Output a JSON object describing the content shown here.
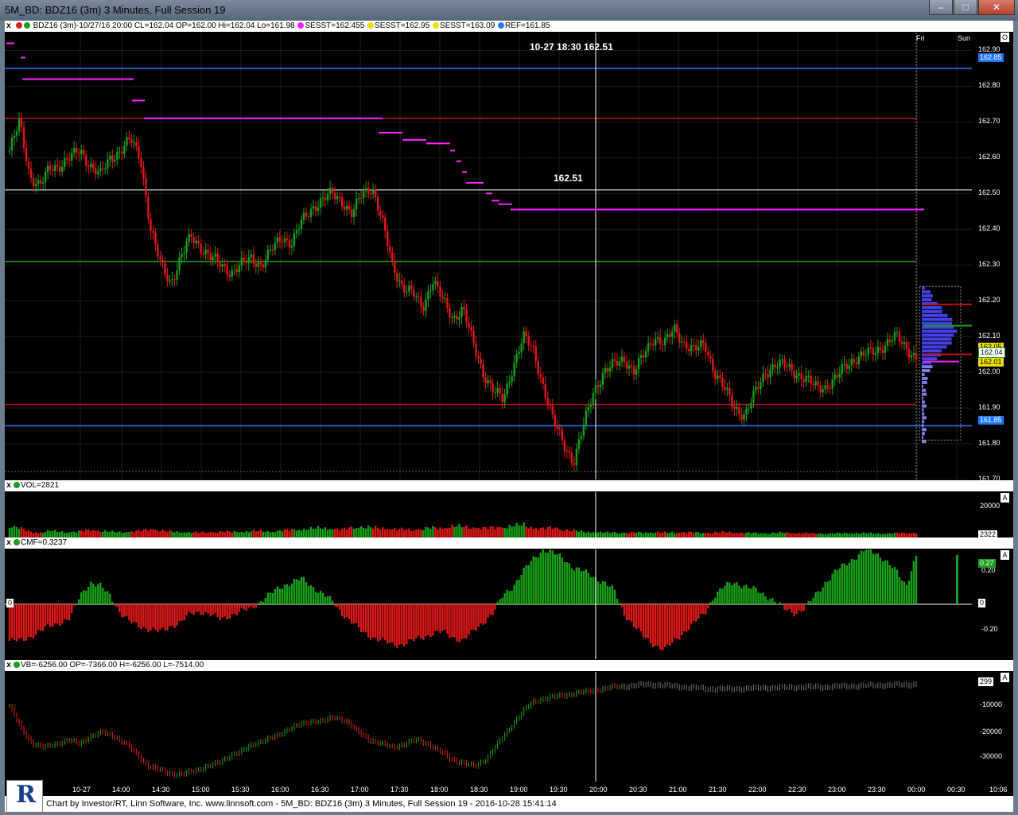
{
  "window": {
    "title": "5M_BD: BDZ16 (3m) 3 Minutes, Full Session 19",
    "buttons": [
      "–",
      "□",
      "✕"
    ]
  },
  "price_panel": {
    "header": {
      "close_label": "x",
      "summary": "BDZ16 (3m)-10/27/16 20:00 CL=162.04 OP=162.00 Hi=162.04 Lo=161.98",
      "sesst1": "SESST=162.455",
      "sesst2": "SESST=162.95",
      "sesst3": "SESST=163.09",
      "ref": "REF=161.85"
    },
    "crosshair_label": "10-27 18:30  162.51",
    "line_label": "162.51",
    "day_labels": [
      "Fri",
      "Sun"
    ],
    "corner_button": "O",
    "y_ticks": [
      "162.90",
      "162.80",
      "162.70",
      "162.60",
      "162.50",
      "162.40",
      "162.30",
      "162.20",
      "162.10",
      "162.00",
      "161.90",
      "161.80",
      "161.70"
    ],
    "tags": {
      "ref_top": "162.85",
      "ref_bottom": "161.85",
      "last": "162.04",
      "yellow1": "162.05",
      "yellow2": "162.01"
    }
  },
  "vol_panel": {
    "header": "VOL=2821",
    "button": "A",
    "y_tick": "20000",
    "last": "2322"
  },
  "cmf_panel": {
    "header": "CMF=0.3237",
    "button": "A",
    "ticks": [
      "0.20",
      "0",
      "-0.20"
    ],
    "last": "0.27",
    "zero": "0"
  },
  "vb_panel": {
    "header": "VB=-6256.00 OP=-7366.00 H=-6256.00 L=-7514.00",
    "button": "A",
    "ticks": [
      "-10000",
      "-20000",
      "-30000"
    ],
    "last": "299"
  },
  "time_axis": [
    "10-27",
    "14:00",
    "14:30",
    "15:00",
    "15:30",
    "16:00",
    "16:30",
    "17:00",
    "17:30",
    "18:00",
    "18:30",
    "19:00",
    "19:30",
    "20:00",
    "20:30",
    "21:00",
    "21:30",
    "22:00",
    "22:30",
    "23:00",
    "23:30",
    "00:00",
    "00:30",
    "10:06"
  ],
  "footer": {
    "credit": "Chart by Investor/RT, Linn Software, Inc. www.linnsoft.com - 5M_BD: BDZ16 (3m) 3 Minutes, Full Session 19 - 2016-10-28 15:41:14",
    "logo_letter": "R"
  },
  "chart_data": {
    "type": "candlestick",
    "symbol": "BDZ16",
    "price_path": [
      162.62,
      162.7,
      162.55,
      162.52,
      162.57,
      162.58,
      162.6,
      162.62,
      162.58,
      162.55,
      162.6,
      162.62,
      162.65,
      162.6,
      162.4,
      162.3,
      162.25,
      162.32,
      162.38,
      162.35,
      162.32,
      162.3,
      162.28,
      162.3,
      162.32,
      162.3,
      162.34,
      162.38,
      162.36,
      162.42,
      162.46,
      162.48,
      162.5,
      162.48,
      162.44,
      162.5,
      162.52,
      162.42,
      162.3,
      162.24,
      162.22,
      162.18,
      162.26,
      162.2,
      162.15,
      162.18,
      162.08,
      162.0,
      161.95,
      161.92,
      162.02,
      162.1,
      162.06,
      161.96,
      161.86,
      161.8,
      161.75,
      161.85,
      161.95,
      162.0,
      162.02,
      162.04,
      162.0,
      162.05,
      162.1,
      162.08,
      162.12,
      162.08,
      162.06,
      162.08,
      162.0,
      161.95,
      161.9,
      161.88,
      161.94,
      162.0,
      162.02,
      162.02,
      162.0,
      161.98,
      161.96,
      161.96,
      161.98,
      162.02,
      162.04,
      162.05,
      162.06,
      162.08,
      162.1,
      162.07,
      162.04
    ],
    "reference_lines": [
      162.85,
      162.71,
      162.31,
      161.91,
      161.85
    ],
    "crosshair": {
      "time": "10-27 18:30",
      "price": 162.51
    },
    "sesst_levels": [
      162.455,
      162.95,
      163.09
    ],
    "vol_path": [
      6000,
      5000,
      3000,
      2500,
      3500,
      3000,
      2800,
      3200,
      4000,
      3500,
      3000,
      2800,
      3000,
      3500,
      4500,
      3800,
      3000,
      2800,
      2700,
      2600,
      2800,
      3000,
      2900,
      3000,
      3200,
      3400,
      3000,
      3500,
      4000,
      4200,
      4500,
      5000,
      4500,
      4000,
      5200,
      5500,
      5000,
      4800,
      4500,
      4200,
      4000,
      4500,
      5000,
      4800,
      6000,
      5500,
      5200,
      4800,
      5000,
      5500,
      6000,
      6500,
      5000,
      4500,
      5200,
      4000,
      3500,
      3000,
      2800,
      2500,
      2600,
      2400,
      2500,
      2600,
      2700,
      2500,
      2600,
      2700,
      2500,
      2400,
      2600,
      2800,
      2500,
      2400,
      2300,
      2200,
      2400,
      2500,
      2300,
      2200,
      2100,
      2000,
      2100,
      2200,
      2300,
      2200,
      2100,
      2000,
      2200,
      2322,
      2322
    ],
    "cmf_path": [
      -0.2,
      -0.2,
      -0.18,
      -0.15,
      -0.12,
      -0.1,
      -0.08,
      0.05,
      0.12,
      0.1,
      0.05,
      -0.05,
      -0.1,
      -0.12,
      -0.14,
      -0.15,
      -0.12,
      -0.1,
      -0.05,
      -0.04,
      -0.06,
      -0.08,
      -0.06,
      -0.04,
      -0.02,
      0.02,
      0.06,
      0.1,
      0.12,
      0.14,
      0.1,
      0.06,
      0.02,
      -0.05,
      -0.1,
      -0.15,
      -0.18,
      -0.2,
      -0.22,
      -0.22,
      -0.2,
      -0.18,
      -0.16,
      -0.15,
      -0.18,
      -0.2,
      -0.15,
      -0.1,
      -0.05,
      0.05,
      0.1,
      0.18,
      0.25,
      0.3,
      0.28,
      0.25,
      0.2,
      0.18,
      0.15,
      0.12,
      0.08,
      -0.05,
      -0.12,
      -0.18,
      -0.22,
      -0.25,
      -0.2,
      -0.15,
      -0.1,
      -0.05,
      0.05,
      0.1,
      0.12,
      0.1,
      0.08,
      0.05,
      0.02,
      -0.03,
      -0.05,
      -0.02,
      0.05,
      0.12,
      0.18,
      0.22,
      0.26,
      0.3,
      0.28,
      0.24,
      0.18,
      0.1,
      0.27
    ],
    "vb_path": [
      -12000,
      -18000,
      -22000,
      -23000,
      -22000,
      -21000,
      -22000,
      -20000,
      -19000,
      -20000,
      -22000,
      -25000,
      -28000,
      -29000,
      -30000,
      -30000,
      -29000,
      -28000,
      -27000,
      -25000,
      -24000,
      -22000,
      -21000,
      -20000,
      -18000,
      -17000,
      -16000,
      -16000,
      -15000,
      -16000,
      -19000,
      -21000,
      -22000,
      -23000,
      -22000,
      -21000,
      -22000,
      -24000,
      -26000,
      -27000,
      -28000,
      -26000,
      -22000,
      -18000,
      -14000,
      -11000,
      -10000,
      -9500,
      -9000,
      -8500,
      -8000,
      -7500,
      -7000,
      -6800,
      -6500,
      -6300,
      -6500,
      -6800,
      -7000,
      -7200,
      -7500,
      -7500,
      -7500,
      -7400,
      -7300,
      -7200,
      -7200,
      -7100,
      -7000,
      -7000,
      -7000,
      -6900,
      -6800,
      -6700,
      -6600,
      -6500,
      -6500,
      -6400,
      -6256
    ],
    "ylim_price": [
      161.7,
      162.95
    ],
    "ylim_cmf": [
      -0.3,
      0.3
    ],
    "ylim_vb": [
      -32000,
      -3000
    ],
    "colors": {
      "up": "#18a018",
      "down": "#e01818",
      "ref_blue": "#1e78ff",
      "ref_red": "#c81010",
      "ref_green": "#18a018",
      "sesst": "#ff20ff"
    }
  }
}
